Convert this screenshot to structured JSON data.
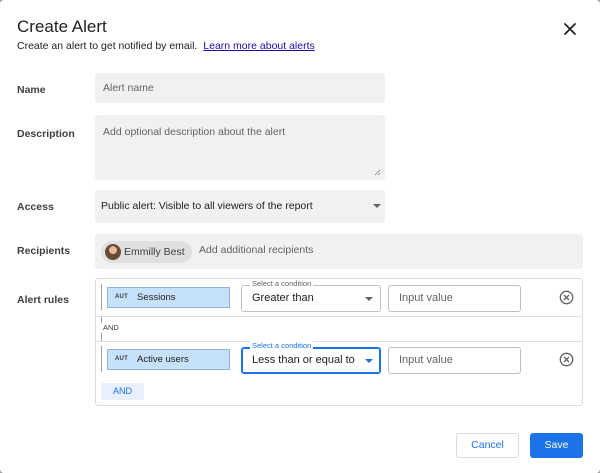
{
  "dialog": {
    "title": "Create Alert",
    "subtitle": "Create an alert to get notified by email.",
    "learn_more": "Learn more about alerts"
  },
  "form": {
    "name_label": "Name",
    "name_placeholder": "Alert name",
    "description_label": "Description",
    "description_placeholder": "Add optional description about the alert",
    "access_label": "Access",
    "access_value": "Public alert: Visible to all viewers of the report",
    "recipients_label": "Recipients",
    "recipient_chip": "Emmilly Best",
    "recipients_placeholder": "Add additional recipients",
    "alert_rules_label": "Alert rules"
  },
  "rules": [
    {
      "metric_tag": "AUT",
      "metric": "Sessions",
      "condition_legend": "Select a condition",
      "condition": "Greater than",
      "value_placeholder": "Input value"
    },
    {
      "metric_tag": "AUT",
      "metric": "Active users",
      "condition_legend": "Select a condition",
      "condition": "Less than or equal to",
      "value_placeholder": "Input value"
    }
  ],
  "rules_joiner": "AND",
  "add_and_label": "AND",
  "buttons": {
    "cancel": "Cancel",
    "save": "Save"
  },
  "colors": {
    "accent": "#1a73e8",
    "metric_chip": "#c6e1fa",
    "field_bg": "#f1f1f1"
  },
  "icons": {
    "close": "close-icon",
    "remove": "remove-circle-icon",
    "dropdown": "chevron-down-icon"
  }
}
